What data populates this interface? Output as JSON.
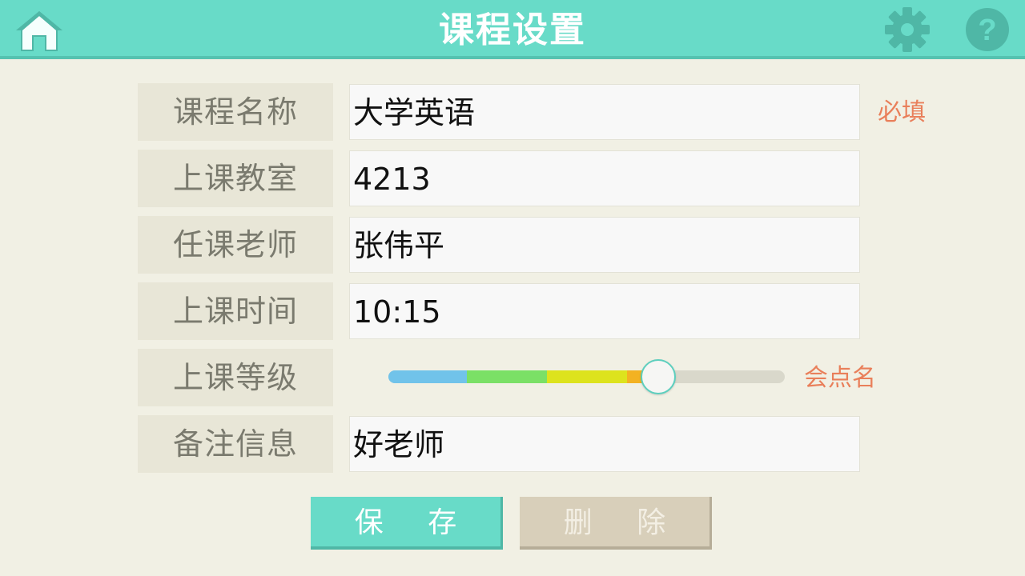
{
  "header": {
    "title": "课程设置",
    "home_icon": "home-icon",
    "settings_icon": "gear-icon",
    "help_icon": "help-icon"
  },
  "form": {
    "course_name": {
      "label": "课程名称",
      "value": "大学英语",
      "hint": "必填"
    },
    "classroom": {
      "label": "上课教室",
      "value": "4213"
    },
    "teacher": {
      "label": "任课老师",
      "value": "张伟平"
    },
    "time": {
      "label": "上课时间",
      "value": "10:15"
    },
    "level": {
      "label": "上课等级",
      "value_fraction": 0.68,
      "status": "会点名"
    },
    "notes": {
      "label": "备注信息",
      "value": "好老师"
    }
  },
  "buttons": {
    "save": "保 存",
    "delete": "删 除"
  },
  "colors": {
    "header": "#68dbc8",
    "background": "#f1f0e4",
    "hint": "#e97f5a",
    "save_button": "#68dbc8",
    "delete_button": "#d8cfba"
  }
}
